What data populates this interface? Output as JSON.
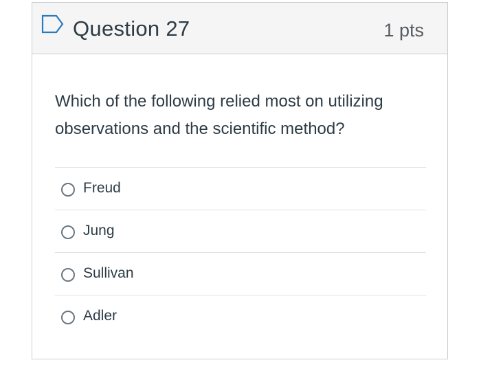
{
  "question": {
    "title": "Question 27",
    "points": "1 pts",
    "text": "Which of the following relied most on utilizing observations and the scientific method?",
    "flag_icon": "bookmark-flag-icon",
    "accent_color": "#2b7abc"
  },
  "answers": [
    {
      "label": "Freud",
      "selected": false
    },
    {
      "label": "Jung",
      "selected": false
    },
    {
      "label": "Sullivan",
      "selected": false
    },
    {
      "label": "Adler",
      "selected": false
    }
  ]
}
